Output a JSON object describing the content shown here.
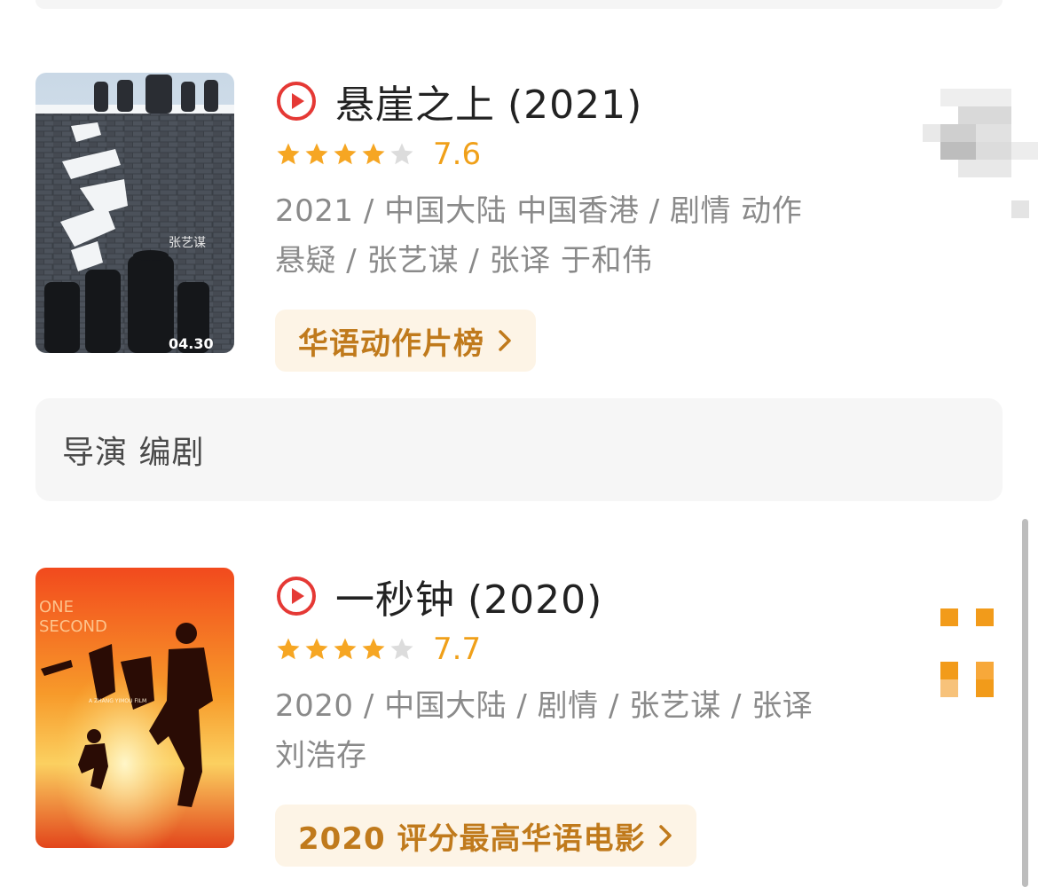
{
  "movies": [
    {
      "title": "悬崖之上",
      "year": "(2021)",
      "rating": "7.6",
      "stars_filled": 4,
      "stars_total": 5,
      "meta": "2021 / 中国大陆 中国香港 / 剧情 动作 悬疑 / 张艺谋 / 张译 于和伟",
      "chart_label": "华语动作片榜",
      "poster": {
        "release_text": "04.30",
        "director_text": "张艺谋"
      }
    },
    {
      "title": "一秒钟",
      "year": "(2020)",
      "rating": "7.7",
      "stars_filled": 4,
      "stars_total": 5,
      "meta": "2020 / 中国大陆 / 剧情 / 张艺谋 / 张译 刘浩存",
      "chart_label": "2020 评分最高华语电影",
      "poster": {
        "english_title_1": "ONE",
        "english_title_2": "SECOND",
        "film_credit": "A ZHANG YIMOU FILM"
      }
    }
  ],
  "role_card": {
    "label": "导演 编剧"
  },
  "colors": {
    "accent": "#e53935",
    "star": "#f6a623",
    "star_empty": "#dcdcdc",
    "tag_bg": "#fdf4e6",
    "tag_text": "#c07a1c",
    "meta_text": "#8a8a8a",
    "title_text": "#222222"
  },
  "icons": {
    "play": "play-circle-icon",
    "star": "star-icon",
    "chevron": "chevron-right-icon"
  }
}
